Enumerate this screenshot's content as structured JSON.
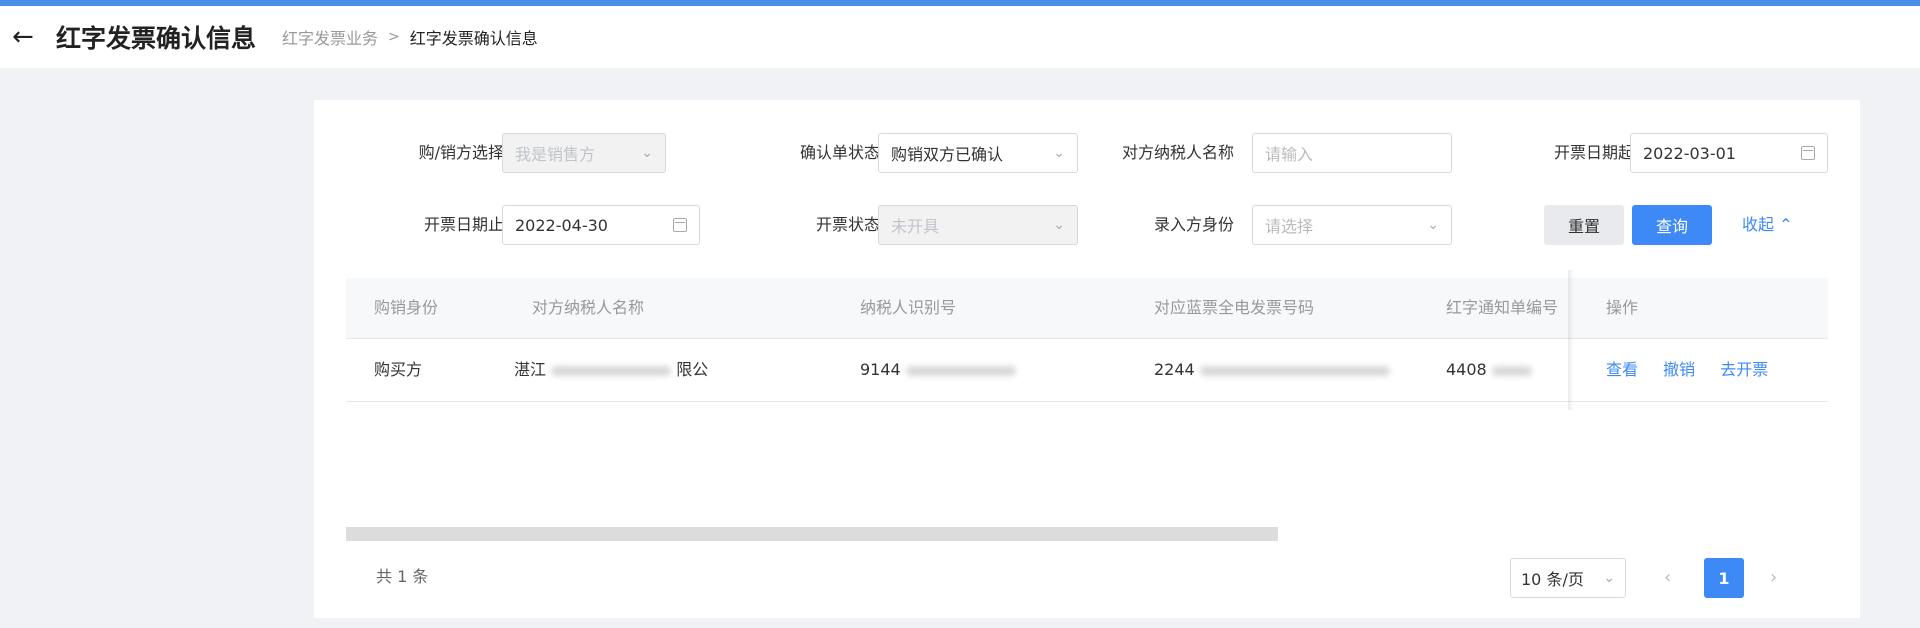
{
  "header": {
    "back_icon": "arrow-left-icon",
    "title": "红字发票确认信息",
    "breadcrumb": {
      "parent": "红字发票业务",
      "separator": ">",
      "current": "红字发票确认信息"
    }
  },
  "filters": {
    "buyer_seller": {
      "label": "购/销方选择",
      "value": "我是销售方"
    },
    "confirm_status": {
      "label": "确认单状态",
      "value": "购销双方已确认"
    },
    "counterparty_name": {
      "label": "对方纳税人名称",
      "placeholder": "请输入"
    },
    "date_start": {
      "label": "开票日期起",
      "value": "2022-03-01"
    },
    "date_end": {
      "label": "开票日期止",
      "value": "2022-04-30"
    },
    "invoice_status": {
      "label": "开票状态",
      "value": "未开具"
    },
    "entry_identity": {
      "label": "录入方身份",
      "placeholder": "请选择"
    }
  },
  "actions": {
    "reset": "重置",
    "query": "查询",
    "collapse": "收起"
  },
  "table": {
    "columns": [
      "购销身份",
      "对方纳税人名称",
      "纳税人识别号",
      "对应蓝票全电发票号码",
      "红字通知单编号",
      "操作"
    ],
    "rows": [
      {
        "identity": "购买方",
        "name_start": "湛江",
        "name_end": "限公",
        "tax_id": "9144",
        "invoice_no": "2244",
        "notice_no": "4408",
        "ops": [
          "查看",
          "撤销",
          "去开票"
        ]
      }
    ]
  },
  "pagination": {
    "total": "共 1 条",
    "page_size": "10 条/页",
    "current_page": "1"
  },
  "colors": {
    "accent": "#3d8af7",
    "topbar": "#4a8fe7"
  }
}
